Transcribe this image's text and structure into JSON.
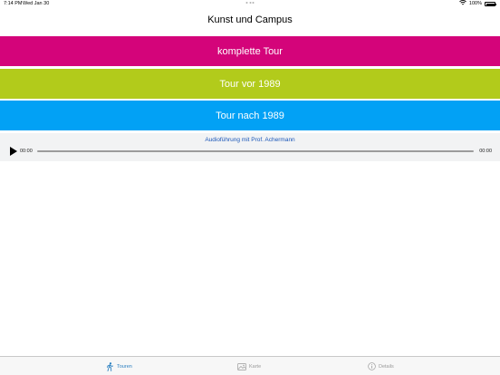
{
  "status_bar": {
    "time": "7:14 PM",
    "date": "Wed Jan 30",
    "battery": "100%"
  },
  "nav": {
    "title": "Kunst und Campus"
  },
  "tours": [
    {
      "label": "komplette Tour",
      "color": "#d4047a"
    },
    {
      "label": "Tour vor 1989",
      "color": "#b2cb1b"
    },
    {
      "label": "Tour nach 1989",
      "color": "#02a1f5"
    }
  ],
  "audio": {
    "title": "Audioführung mit Prof. Achermann",
    "current_time": "00:00",
    "duration": "00:00",
    "progress": 0
  },
  "tab_bar": {
    "items": [
      {
        "label": "Touren",
        "icon": "hiker-icon",
        "active": true
      },
      {
        "label": "Karte",
        "icon": "map-image-icon",
        "active": false
      },
      {
        "label": "Details",
        "icon": "info-icon",
        "active": false
      }
    ],
    "active_color": "#2a7fc0"
  }
}
